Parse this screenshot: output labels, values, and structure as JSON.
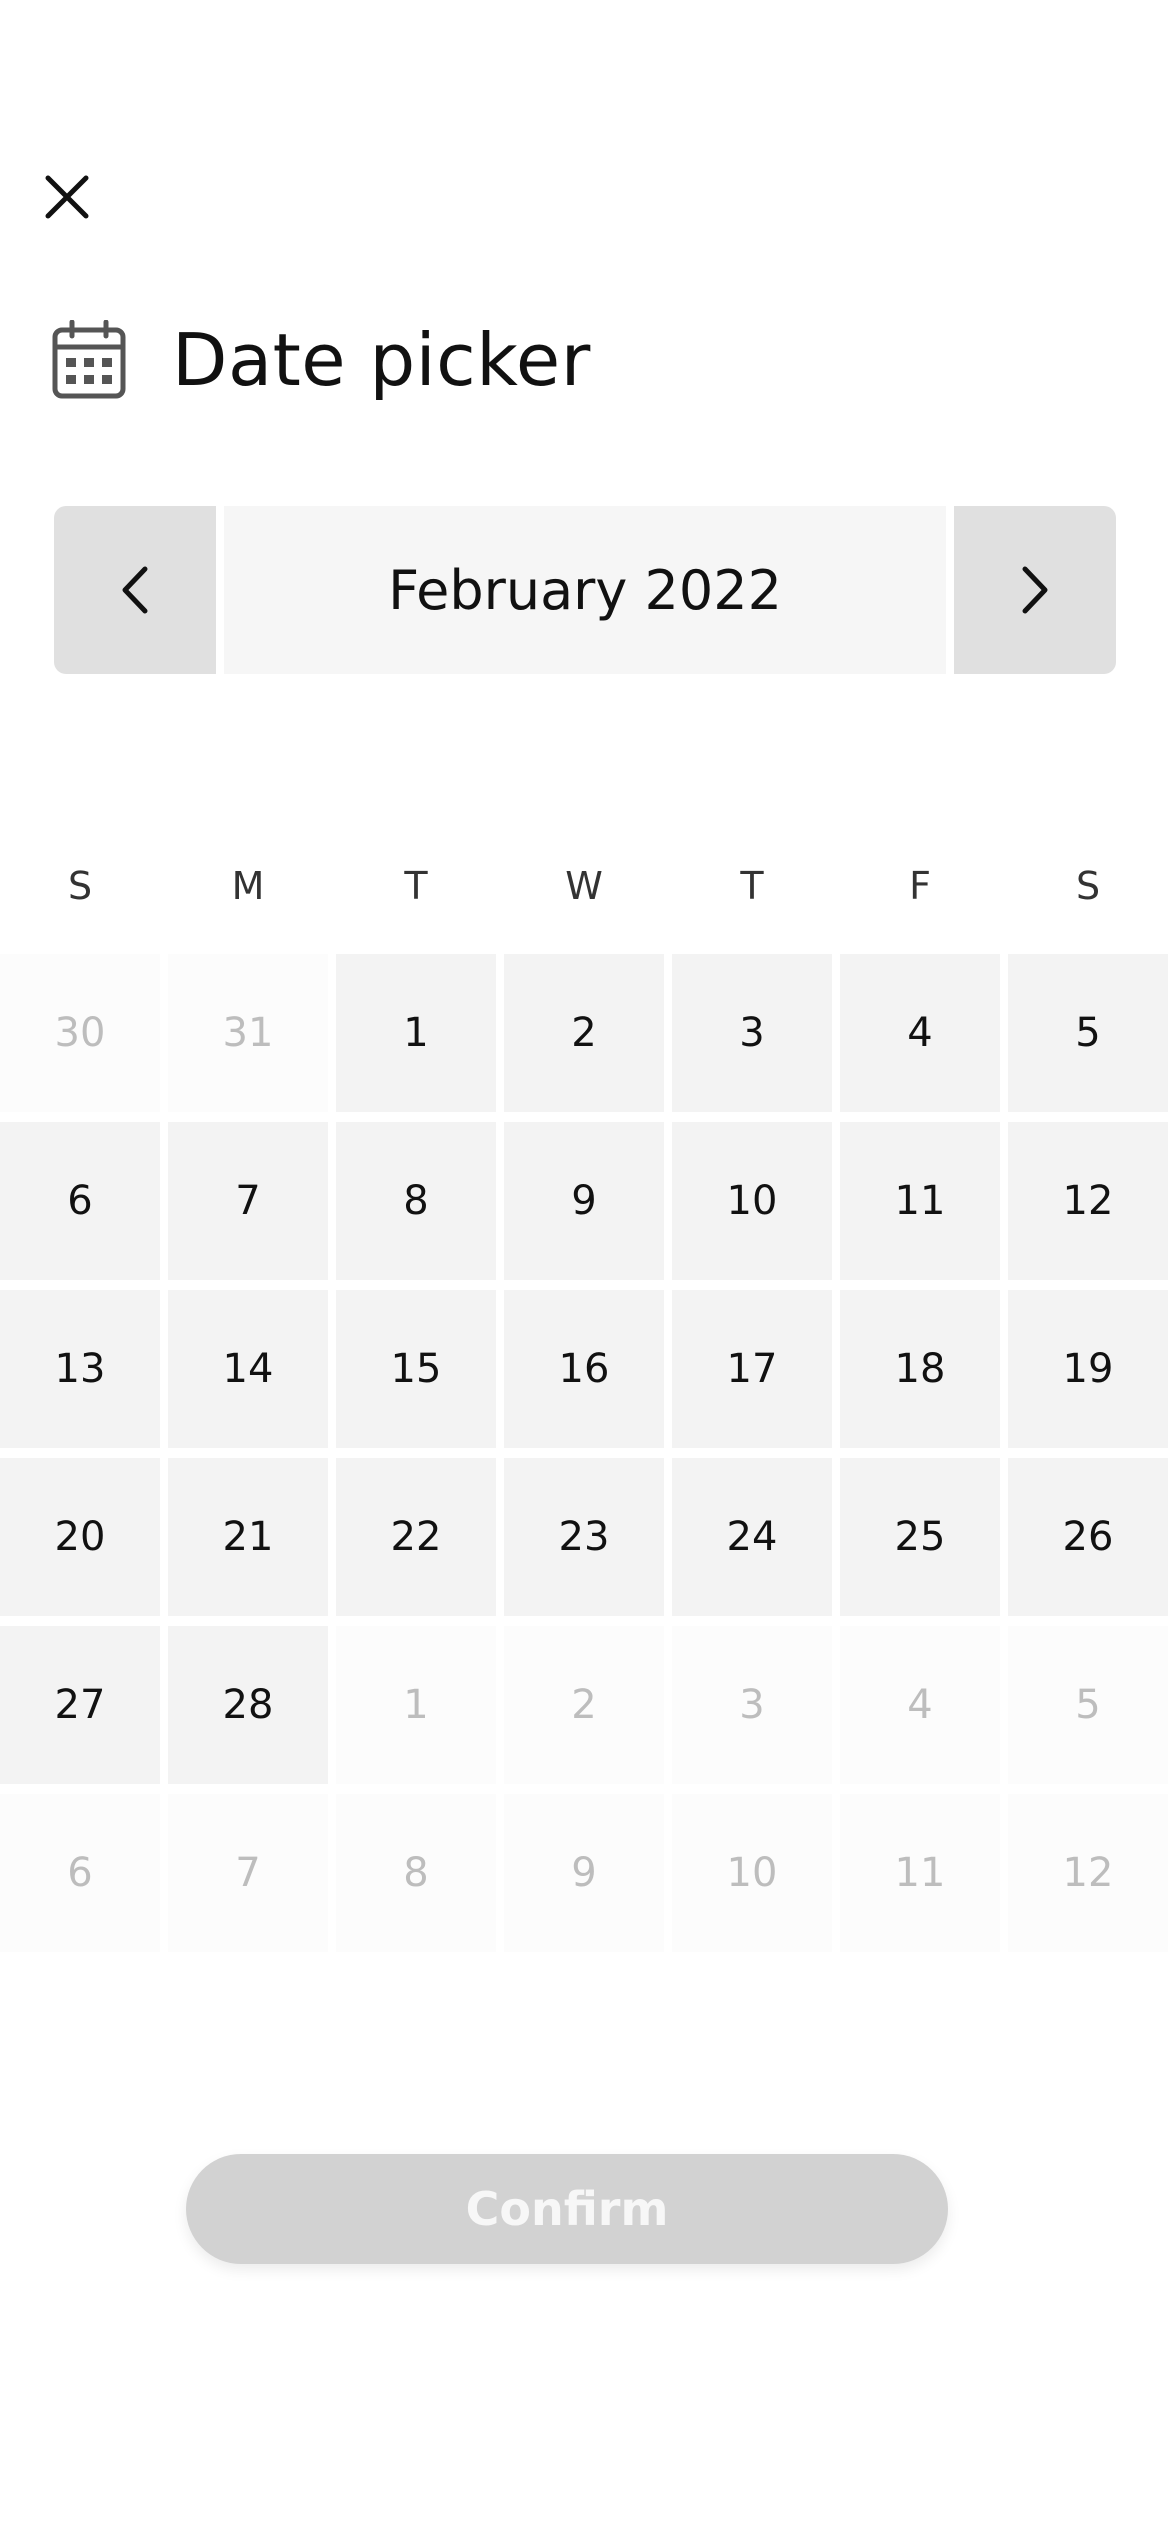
{
  "header": {
    "close_icon": "close-icon",
    "calendar_icon": "calendar-icon",
    "title": "Date picker"
  },
  "month_nav": {
    "prev_icon": "chevron-left-icon",
    "next_icon": "chevron-right-icon",
    "label": "February 2022"
  },
  "weekdays": [
    "S",
    "M",
    "T",
    "W",
    "T",
    "F",
    "S"
  ],
  "days": [
    {
      "label": "30",
      "in_month": false
    },
    {
      "label": "31",
      "in_month": false
    },
    {
      "label": "1",
      "in_month": true
    },
    {
      "label": "2",
      "in_month": true
    },
    {
      "label": "3",
      "in_month": true
    },
    {
      "label": "4",
      "in_month": true
    },
    {
      "label": "5",
      "in_month": true
    },
    {
      "label": "6",
      "in_month": true
    },
    {
      "label": "7",
      "in_month": true
    },
    {
      "label": "8",
      "in_month": true
    },
    {
      "label": "9",
      "in_month": true
    },
    {
      "label": "10",
      "in_month": true
    },
    {
      "label": "11",
      "in_month": true
    },
    {
      "label": "12",
      "in_month": true
    },
    {
      "label": "13",
      "in_month": true
    },
    {
      "label": "14",
      "in_month": true
    },
    {
      "label": "15",
      "in_month": true
    },
    {
      "label": "16",
      "in_month": true
    },
    {
      "label": "17",
      "in_month": true
    },
    {
      "label": "18",
      "in_month": true
    },
    {
      "label": "19",
      "in_month": true
    },
    {
      "label": "20",
      "in_month": true
    },
    {
      "label": "21",
      "in_month": true
    },
    {
      "label": "22",
      "in_month": true
    },
    {
      "label": "23",
      "in_month": true
    },
    {
      "label": "24",
      "in_month": true
    },
    {
      "label": "25",
      "in_month": true
    },
    {
      "label": "26",
      "in_month": true
    },
    {
      "label": "27",
      "in_month": true
    },
    {
      "label": "28",
      "in_month": true
    },
    {
      "label": "1",
      "in_month": false
    },
    {
      "label": "2",
      "in_month": false
    },
    {
      "label": "3",
      "in_month": false
    },
    {
      "label": "4",
      "in_month": false
    },
    {
      "label": "5",
      "in_month": false
    },
    {
      "label": "6",
      "in_month": false
    },
    {
      "label": "7",
      "in_month": false
    },
    {
      "label": "8",
      "in_month": false
    },
    {
      "label": "9",
      "in_month": false
    },
    {
      "label": "10",
      "in_month": false
    },
    {
      "label": "11",
      "in_month": false
    },
    {
      "label": "12",
      "in_month": false
    }
  ],
  "confirm": {
    "label": "Confirm",
    "enabled": false
  },
  "colors": {
    "day_bg": "#f3f3f3",
    "day_muted_bg": "#fcfcfc",
    "day_muted_text": "#bdbdbd",
    "nav_button_bg": "#e0e0e0",
    "month_label_bg": "#f6f6f6",
    "confirm_disabled_bg": "#d2d2d2"
  }
}
